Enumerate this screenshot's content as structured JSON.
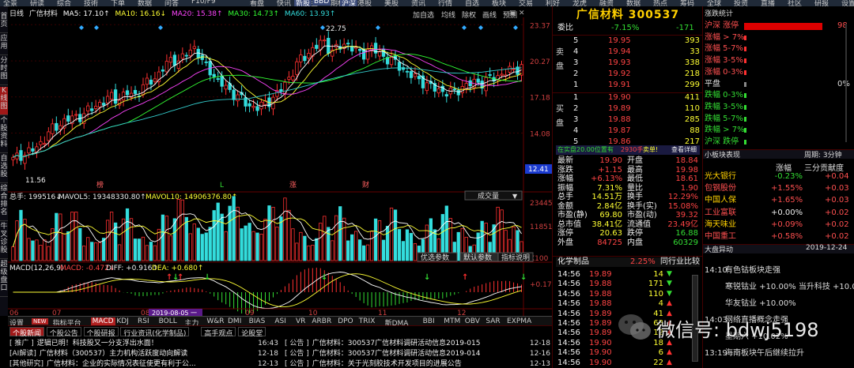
{
  "toolbar": {
    "items": [
      "全景",
      "研读",
      "综合",
      "技術",
      "下单",
      "数据",
      "问答",
      "F10/F9",
      "看盘",
      "快讯",
      "基金",
      "期权",
      "港股",
      "美股",
      "资讯",
      "行情",
      "自选",
      "板块",
      "交易",
      "利好",
      "龙虎",
      "融资",
      "数据",
      "热点",
      "筹码",
      "全球",
      "投资",
      "直播",
      "社区",
      "研报",
      "设置",
      "参谋",
      "视频",
      "帮助"
    ],
    "highlight_items": [
      "新股",
      "BBD",
      "沪深"
    ]
  },
  "left_sidebar": {
    "items": [
      "首页",
      "应用",
      "分时图",
      "K线图",
      "个股资料",
      "自选股",
      "综合排名",
      "牛叉诊股",
      "超级盘口"
    ],
    "active": "K线图"
  },
  "chart": {
    "title_row": {
      "period": "日线",
      "name": "广信材料",
      "ma5": "MA5: 17.10↑",
      "ma10": "MA10: 16.16↓",
      "ma20": "MA20: 15.38↑",
      "ma30": "MA30: 14.73↑",
      "ma60": "MA60: 13.93↑"
    },
    "tools": [
      "加自选",
      "均线",
      "除权",
      "画线",
      "预测"
    ],
    "price_ticks": [
      "23.37",
      "20.27",
      "17.18",
      "14.08"
    ],
    "current_price_tag": "12.41",
    "high_label": "22.75",
    "low_label": "11.56",
    "event_marks": [
      "榜",
      "L",
      "涨",
      "财"
    ],
    "volume_header": {
      "total": "总手: 199516↓",
      "mavol5": "MAVOL5: 19348330.80↑",
      "mavol10": "MAVOL10: 14906376.80↑",
      "button": "成交量"
    },
    "volume_ticks": [
      "23445",
      "11851",
      "X100"
    ],
    "volume_buttons": [
      "优选参数",
      "默认参数",
      "指标说明"
    ],
    "macd_header": {
      "label": "MACD(12,26,9)",
      "macd": "MACD: -0.472↓",
      "diff": "DIFF: +0.916↑",
      "dea": "DEA: +0.680↑"
    },
    "macd_ticks": [
      "+0.175"
    ],
    "date_ticks": [
      "06",
      "07",
      "08",
      "09",
      "10",
      "11",
      "12"
    ],
    "date_highlight": "2019-08-05 一"
  },
  "bottom_tabs": {
    "items": [
      "设置",
      "NEW",
      "指标平台",
      "MACD",
      "KDJ",
      "RSI",
      "BOLL",
      "主力",
      "W&R",
      "DMI",
      "BIAS",
      "ASI",
      "VR",
      "ARBR",
      "DPO",
      "TRIX",
      "新DMA",
      "BBI",
      "MTM",
      "OBV",
      "SAR",
      "EXPMA"
    ],
    "active": "MACD"
  },
  "news": {
    "tabs": [
      "个股新闻",
      "个股公告",
      "个股研报",
      "行业资讯(化学制品)",
      "高手观点",
      "论股堂"
    ],
    "left_rows": [
      {
        "tag": "[ 推广 ]",
        "text": "逻辑已明！科技股又一分支浮出水面！",
        "time": "16:43"
      },
      {
        "tag": "[AI解读]",
        "text": "广信材料（300537）主力机构活跃度动向解读",
        "time": "12-18"
      },
      {
        "tag": "[其他研究]",
        "text": "广信材料：企业的实际情况表征使更有利于公...",
        "time": "12-13"
      }
    ],
    "right_rows": [
      {
        "tag": "[ 公告 ]",
        "text": "广信材料：300537广信材料调研活动信息2019-015",
        "time": "12-18"
      },
      {
        "tag": "[ 公告 ]",
        "text": "广信材料：300537广信材料调研活动信息2019-014",
        "time": "12-16"
      },
      {
        "tag": "[ 公告 ]",
        "text": "广信材料：关于光刻胶技术开发项目的进展公告",
        "time": "12-13"
      }
    ]
  },
  "quote": {
    "name": "广信材料 300537",
    "webi": {
      "label": "委比",
      "pct": "-7.15%",
      "diff": "-171"
    },
    "sell_label": "卖盘",
    "buy_label": "买盘",
    "sells": [
      {
        "lvl": "5",
        "price": "19.95",
        "vol": "393"
      },
      {
        "lvl": "4",
        "price": "19.94",
        "vol": "33"
      },
      {
        "lvl": "3",
        "price": "19.93",
        "vol": "338"
      },
      {
        "lvl": "2",
        "price": "19.92",
        "vol": "218"
      },
      {
        "lvl": "1",
        "price": "19.91",
        "vol": "299"
      }
    ],
    "buys": [
      {
        "lvl": "1",
        "price": "19.90",
        "vol": "411"
      },
      {
        "lvl": "2",
        "price": "19.89",
        "vol": "110"
      },
      {
        "lvl": "3",
        "price": "19.88",
        "vol": "285"
      },
      {
        "lvl": "4",
        "price": "19.87",
        "vol": "88"
      },
      {
        "lvl": "5",
        "price": "19.86",
        "vol": "217"
      }
    ],
    "order_line": {
      "text": "在实盘20.00位置有",
      "vol": "2930手",
      "side": "卖单!",
      "link": "查看详细"
    },
    "stats": [
      {
        "k1": "最新",
        "v1": "19.90",
        "k2": "开盘",
        "v2": "18.84"
      },
      {
        "k1": "涨跌",
        "v1": "+1.15",
        "k2": "最高",
        "v2": "19.98"
      },
      {
        "k1": "涨幅",
        "v1": "+6.13%",
        "k2": "最低",
        "v2": "18.61"
      },
      {
        "k1": "振幅",
        "v1": "7.31%",
        "k2": "量比",
        "v2": "1.90"
      },
      {
        "k1": "总手",
        "v1": "14.51万",
        "k2": "换手",
        "v2": "12.29%"
      },
      {
        "k1": "金额",
        "v1": "2.84亿",
        "k2": "换手(实)",
        "v2": "15.08%"
      },
      {
        "k1": "市盈(静)",
        "v1": "69.80",
        "k2": "市盈(动)",
        "v2": "39.32"
      },
      {
        "k1": "总市值",
        "v1": "38.41亿",
        "k2": "流通值",
        "v2": "23.49亿"
      },
      {
        "k1": "涨停",
        "v1": "20.63",
        "k2": "跌停",
        "v2": "16.88"
      },
      {
        "k1": "外盘",
        "v1": "84725",
        "k2": "内盘",
        "v2": "60329"
      }
    ],
    "sector": {
      "name": "化学制品",
      "pct": "2.25%",
      "link": "同行业比较"
    },
    "ticks": [
      {
        "t": "14:56",
        "p": "19.89",
        "v": "14",
        "d": "down"
      },
      {
        "t": "14:56",
        "p": "19.88",
        "v": "171",
        "d": "down"
      },
      {
        "t": "14:56",
        "p": "19.88",
        "v": "110",
        "d": "down"
      },
      {
        "t": "14:56",
        "p": "19.88",
        "v": "4",
        "d": "up"
      },
      {
        "t": "14:56",
        "p": "19.89",
        "v": "41",
        "d": "up"
      },
      {
        "t": "14:56",
        "p": "19.89",
        "v": "63",
        "d": "up"
      },
      {
        "t": "14:56",
        "p": "19.89",
        "v": "12",
        "d": "up"
      },
      {
        "t": "14:56",
        "p": "19.90",
        "v": "18",
        "d": "up"
      },
      {
        "t": "14:56",
        "p": "19.90",
        "v": "6",
        "d": "up"
      },
      {
        "t": "14:56",
        "p": "19.90",
        "v": "22",
        "d": "up"
      }
    ]
  },
  "right": {
    "rise_header": "涨跌统计",
    "rise_rows": [
      {
        "label": "沪深 涨停",
        "val": "98",
        "bar": 0.95
      },
      {
        "label": "涨幅 > 7%",
        "val": "",
        "bar": 0
      },
      {
        "label": "涨幅 5-7%",
        "val": "",
        "bar": 0
      },
      {
        "label": "涨幅 3-5%",
        "val": "",
        "bar": 0
      },
      {
        "label": "涨幅 0-3%",
        "val": "",
        "bar": 0
      },
      {
        "label": "平盘",
        "val": "0%",
        "bar": 0
      },
      {
        "label": "跌幅 0-3%",
        "val": "",
        "bar": 0
      },
      {
        "label": "跌幅 3-5%",
        "val": "",
        "bar": 0
      },
      {
        "label": "跌幅 5-7%",
        "val": "",
        "bar": 0
      },
      {
        "label": "跌幅 > 7%",
        "val": "",
        "bar": 0
      },
      {
        "label": "沪深 跌停",
        "val": "",
        "bar": 0
      }
    ],
    "sector_header": {
      "title": "小板块表现",
      "period": "周期: 3分钟"
    },
    "sector_cols": [
      "",
      "涨幅",
      "三分贡献度"
    ],
    "sector_rows": [
      {
        "name": "光大银行",
        "chg": "-0.23%",
        "contrib": "+0.04"
      },
      {
        "name": "包钢股份",
        "chg": "+1.55%",
        "contrib": "+0.03"
      },
      {
        "name": "中国人保",
        "chg": "+1.65%",
        "contrib": "+0.03"
      },
      {
        "name": "工业富联",
        "chg": "+0.00%",
        "contrib": "+0.02"
      },
      {
        "name": "海天味业",
        "chg": "+0.09%",
        "contrib": "+0.02"
      },
      {
        "name": "中国重工",
        "chg": "+0.58%",
        "contrib": "+0.02"
      }
    ],
    "alert_header": {
      "title": "大盘异动",
      "date": "2019-12-24"
    },
    "alerts": [
      {
        "time": "14:10",
        "text": "有色钴板块走强"
      },
      {
        "time": "",
        "text": "寒锐钴业 +10.00%  当升科技 +10.02%"
      },
      {
        "time": "",
        "text": "华友钴业 +10.00%"
      },
      {
        "time": "14:03",
        "text": "网络直播概念走强"
      },
      {
        "time": "",
        "text": "星期六 +10.02%"
      },
      {
        "time": "13:19",
        "text": "海南板块午后继续拉升"
      }
    ]
  },
  "watermark": {
    "text": "微信号: bdwj5198"
  },
  "colors": {
    "up": "#ff4444",
    "down": "#33dd33",
    "accent": "#ffd000",
    "ma5": "#ffffff",
    "ma10": "#ffff00",
    "ma20": "#ff00ff",
    "ma30": "#00ff00",
    "ma60": "#00cccc"
  }
}
